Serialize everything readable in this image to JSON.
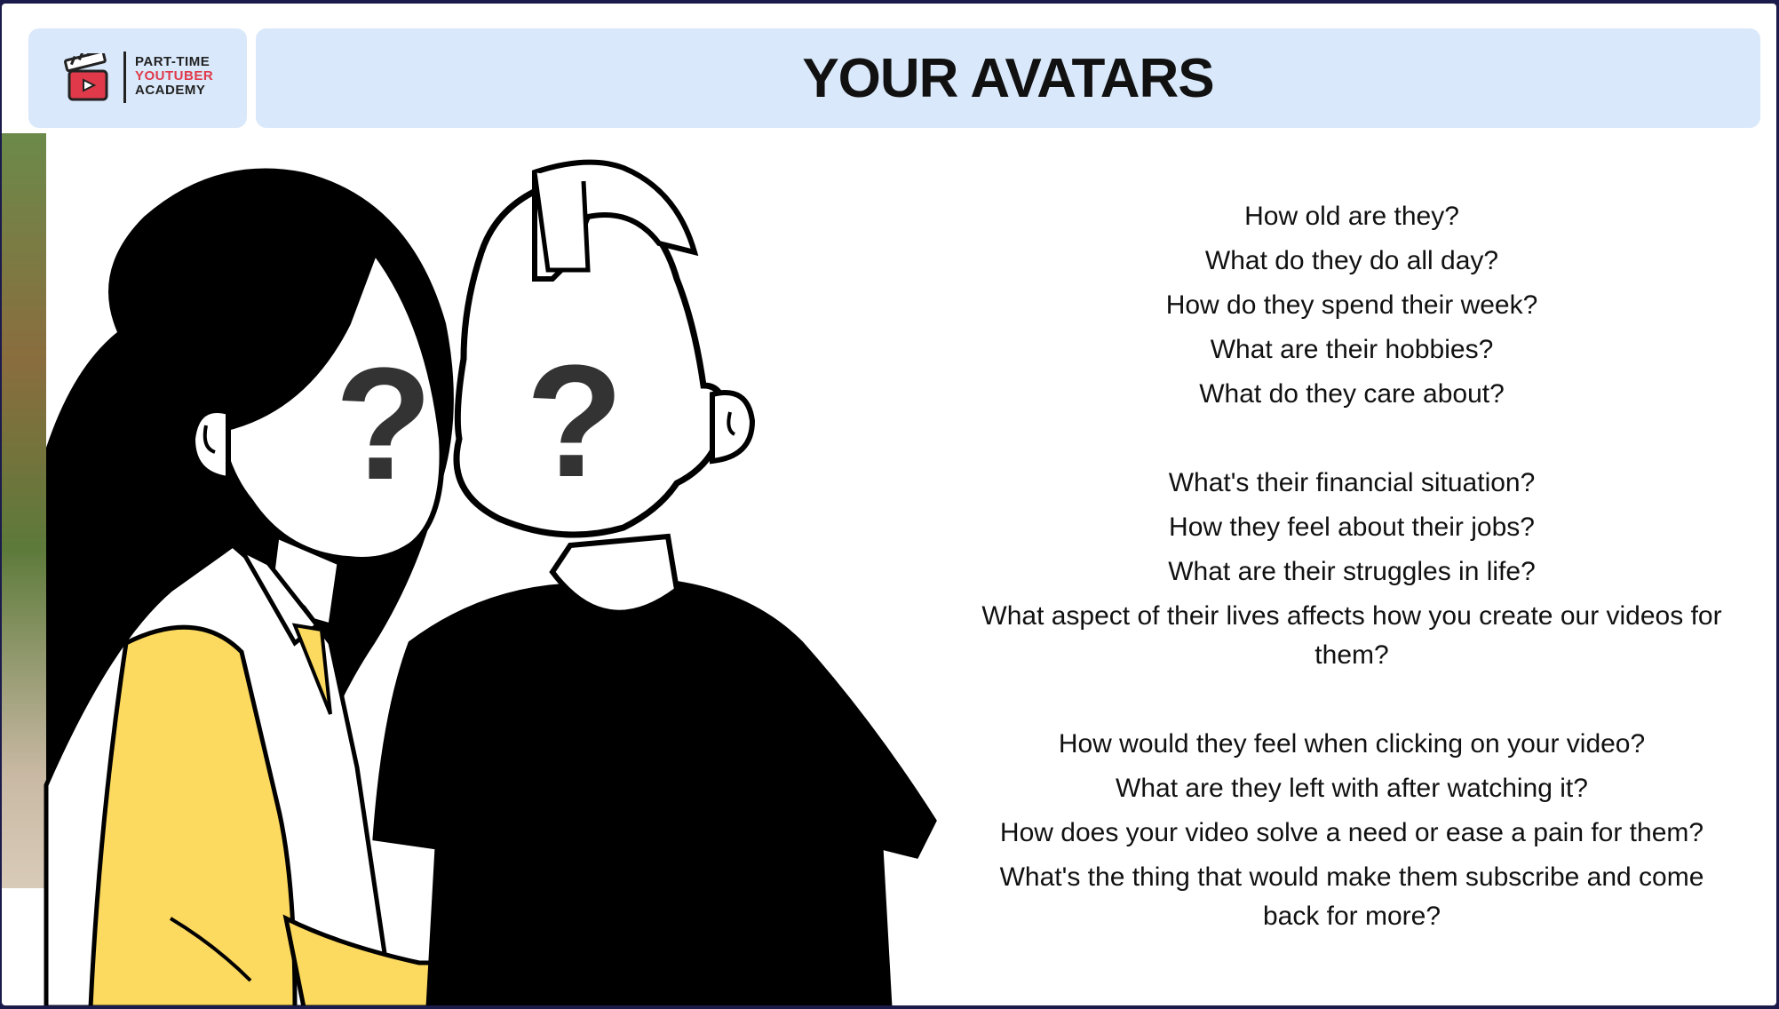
{
  "logo": {
    "line1": "PART-TIME",
    "line2": "YOUTUBER",
    "line3": "ACADEMY",
    "icon": "clapperboard-icon"
  },
  "title": "YOUR AVATARS",
  "illustration": {
    "mark_left": "?",
    "mark_right": "?"
  },
  "questions": {
    "group1": [
      "How old are they?",
      "What do they do all day?",
      "How do they spend their week?",
      "What are their hobbies?",
      "What do they care about?"
    ],
    "group2": [
      "What's their financial situation?",
      "How they feel about their jobs?",
      "What are their struggles in life?",
      "What aspect of their lives affects how you create our videos for them?"
    ],
    "group3": [
      "How would they feel when clicking on your video?",
      "What are they left with after watching it?",
      "How does your video solve a need or ease a pain for them?",
      "What's the thing that would make them subscribe and come back for more?"
    ]
  },
  "colors": {
    "header_bg": "#d9e8fa",
    "accent_yellow": "#fcd95f",
    "logo_red": "#e03a4a",
    "frame": "#1a1b4a"
  }
}
